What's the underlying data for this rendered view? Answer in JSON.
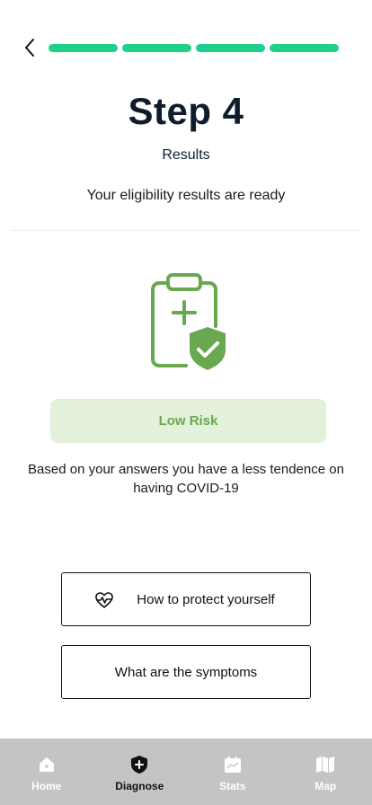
{
  "progress": {
    "steps_total": 4,
    "steps_completed": 4,
    "color": "#1fd08a"
  },
  "page": {
    "title": "Step 4",
    "subtitle": "Results",
    "description": "Your eligibility results are ready"
  },
  "result": {
    "icon": "clipboard-shield-icon",
    "risk_label": "Low Risk",
    "risk_color": "#6aa84f",
    "risk_bg": "#e3f0da",
    "explanation": "Based on your answers you have a less tendence on having COVID-19"
  },
  "actions": {
    "protect_label": "How to protect yourself",
    "protect_icon": "heartbeat-icon",
    "symptoms_label": "What are the symptoms"
  },
  "tabbar": {
    "items": [
      {
        "label": "Home",
        "icon": "home-icon",
        "active": false
      },
      {
        "label": "Diagnose",
        "icon": "shield-plus-icon",
        "active": true
      },
      {
        "label": "Stats",
        "icon": "calendar-stats-icon",
        "active": false
      },
      {
        "label": "Map",
        "icon": "map-icon",
        "active": false
      }
    ]
  }
}
